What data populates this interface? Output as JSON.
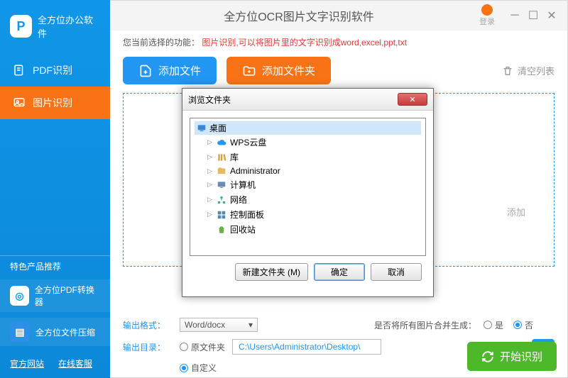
{
  "logo_text": "全方位办公软件",
  "nav": {
    "pdf": "PDF识别",
    "img": "图片识别"
  },
  "promo": {
    "title": "特色产品推荐",
    "item1": "全方位PDF转换器",
    "item2": "全方位文件压缩"
  },
  "footer": {
    "site": "官方网站",
    "service": "在线客服"
  },
  "titlebar": {
    "title": "全方位OCR图片文字识别软件",
    "login": "登录"
  },
  "notice": {
    "prefix": "您当前选择的功能：",
    "desc": "图片识别,可以将图片里的文字识别成word,excel,ppt,txt"
  },
  "actions": {
    "add_file": "添加文件",
    "add_folder": "添加文件夹",
    "clear": "清空列表"
  },
  "drop": {
    "tip_suffix": "添加"
  },
  "options": {
    "format_label": "输出格式：",
    "format_value": "Word/docx",
    "merge_label": "是否将所有图片合并生成：",
    "yes": "是",
    "no": "否",
    "output_label": "输出目录：",
    "orig": "原文件夹",
    "custom": "自定义",
    "path": "C:\\Users\\Administrator\\Desktop\\"
  },
  "start": "开始识别",
  "dialog": {
    "title": "浏览文件夹",
    "root": "桌面",
    "items": [
      "WPS云盘",
      "库",
      "Administrator",
      "计算机",
      "网络",
      "控制面板",
      "回收站"
    ],
    "new_folder": "新建文件夹 (M)",
    "ok": "确定",
    "cancel": "取消"
  }
}
